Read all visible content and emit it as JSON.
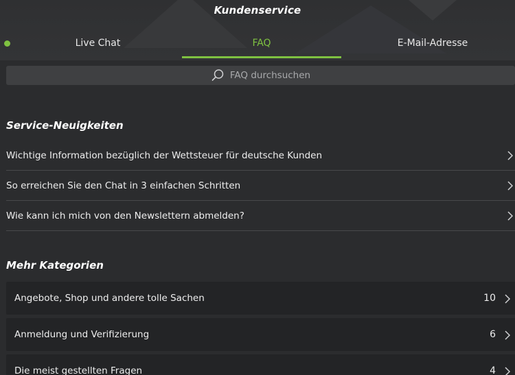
{
  "header": {
    "title": "Kundenservice",
    "tabs": [
      {
        "label": "Live Chat"
      },
      {
        "label": "FAQ"
      },
      {
        "label": "E-Mail-Adresse"
      }
    ],
    "active_tab": "FAQ",
    "online_status_color": "#7fc241"
  },
  "search": {
    "placeholder": "FAQ durchsuchen",
    "icon": "search-icon"
  },
  "news": {
    "title": "Service-Neuigkeiten",
    "items": [
      {
        "label": "Wichtige Information bezüglich der Wettsteuer für deutsche Kunden"
      },
      {
        "label": "So erreichen Sie den Chat in 3 einfachen Schritten"
      },
      {
        "label": "Wie kann ich mich von den Newslettern abmelden?"
      }
    ]
  },
  "categories": {
    "title": "Mehr Kategorien",
    "items": [
      {
        "label": "Angebote, Shop und andere tolle Sachen",
        "count": "10"
      },
      {
        "label": "Anmeldung und Verifizierung",
        "count": "6"
      },
      {
        "label": "Die meist gestellten Fragen",
        "count": "4"
      }
    ]
  },
  "colors": {
    "accent": "#7fc241",
    "background": "#2b2c2e",
    "card": "#232426"
  }
}
